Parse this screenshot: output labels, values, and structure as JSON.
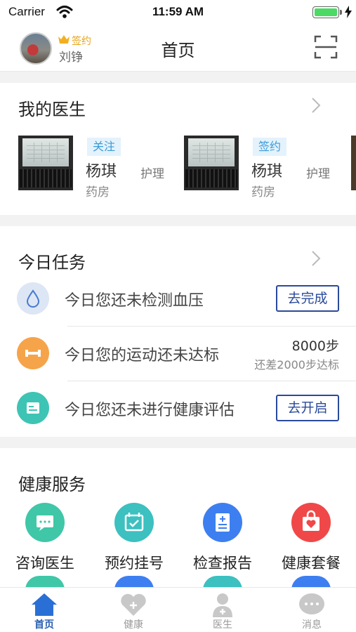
{
  "status_bar": {
    "carrier": "Carrier",
    "time": "11:59 AM"
  },
  "header": {
    "title": "首页",
    "sign_label": "签约",
    "user_name": "刘铮"
  },
  "my_doctors": {
    "title": "我的医生",
    "doctors": [
      {
        "tag": "关注",
        "name": "杨琪",
        "title": "护理",
        "department": "药房"
      },
      {
        "tag": "签约",
        "name": "杨琪",
        "title": "护理",
        "department": "药房"
      }
    ]
  },
  "daily_tasks": {
    "title": "今日任务",
    "items": [
      {
        "text": "今日您还未检测血压",
        "action": "去完成",
        "icon": "water-drop-icon",
        "color": "#dde6f5"
      },
      {
        "text": "今日您的运动还未达标",
        "steps": "8000步",
        "steps_note": "还差2000步达标",
        "icon": "dumbbell-icon",
        "color": "#f5a44a"
      },
      {
        "text": "今日您还未进行健康评估",
        "action": "去开启",
        "icon": "document-icon",
        "color": "#3ec4b4"
      }
    ]
  },
  "health_services": {
    "title": "健康服务",
    "items": [
      {
        "label": "咨询医生",
        "icon": "chat-bubble-icon",
        "color": "#3fc7a8"
      },
      {
        "label": "预约挂号",
        "icon": "calendar-check-icon",
        "color": "#3cc0c0"
      },
      {
        "label": "检查报告",
        "icon": "report-icon",
        "color": "#3d7ff0"
      },
      {
        "label": "健康套餐",
        "icon": "heart-bag-icon",
        "color": "#f04848"
      }
    ]
  },
  "tab_bar": {
    "tabs": [
      {
        "label": "首页",
        "icon": "home-icon",
        "active": true
      },
      {
        "label": "健康",
        "icon": "health-heart-icon",
        "active": false
      },
      {
        "label": "医生",
        "icon": "doctor-icon",
        "active": false
      },
      {
        "label": "消息",
        "icon": "message-icon",
        "active": false
      }
    ]
  },
  "colors": {
    "accent": "#2a5fb0",
    "button_border": "#2a4a9a",
    "tag_text": "#3a9ad9",
    "sign_gold": "#e8a317"
  }
}
